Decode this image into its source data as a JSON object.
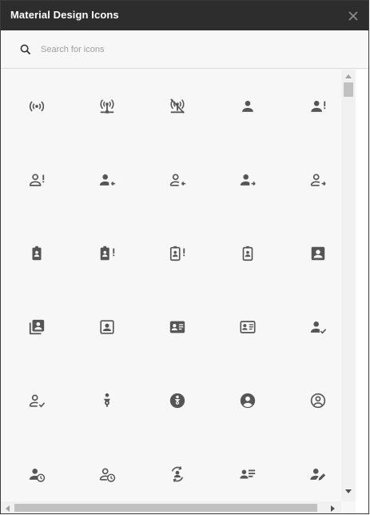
{
  "dialog": {
    "title": "Material Design Icons",
    "close_icon": "close-icon"
  },
  "search": {
    "icon": "search-icon",
    "placeholder": "Search for icons",
    "value": ""
  },
  "icons": [
    "access-point-icon",
    "access-point-network-icon",
    "access-point-network-off-icon",
    "account-icon",
    "account-alert-icon",
    "account-alert-outline-icon",
    "account-arrow-left-icon",
    "account-arrow-left-outline-icon",
    "account-arrow-right-icon",
    "account-arrow-right-outline-icon",
    "account-badge-icon",
    "account-badge-alert-icon",
    "account-badge-alert-outline-icon",
    "account-badge-outline-icon",
    "account-box-icon",
    "account-box-multiple-icon",
    "account-box-outline-icon",
    "account-card-details-icon",
    "account-card-details-outline-icon",
    "account-check-icon",
    "account-check-outline-icon",
    "account-child-icon",
    "account-child-circle-icon",
    "account-circle-icon",
    "account-circle-outline-icon",
    "account-clock-icon",
    "account-clock-outline-icon",
    "account-convert-icon",
    "account-details-icon",
    "account-edit-icon"
  ],
  "colors": {
    "titlebar": "#2d2d2d",
    "background": "#f7f7f7",
    "icon": "#555555"
  }
}
